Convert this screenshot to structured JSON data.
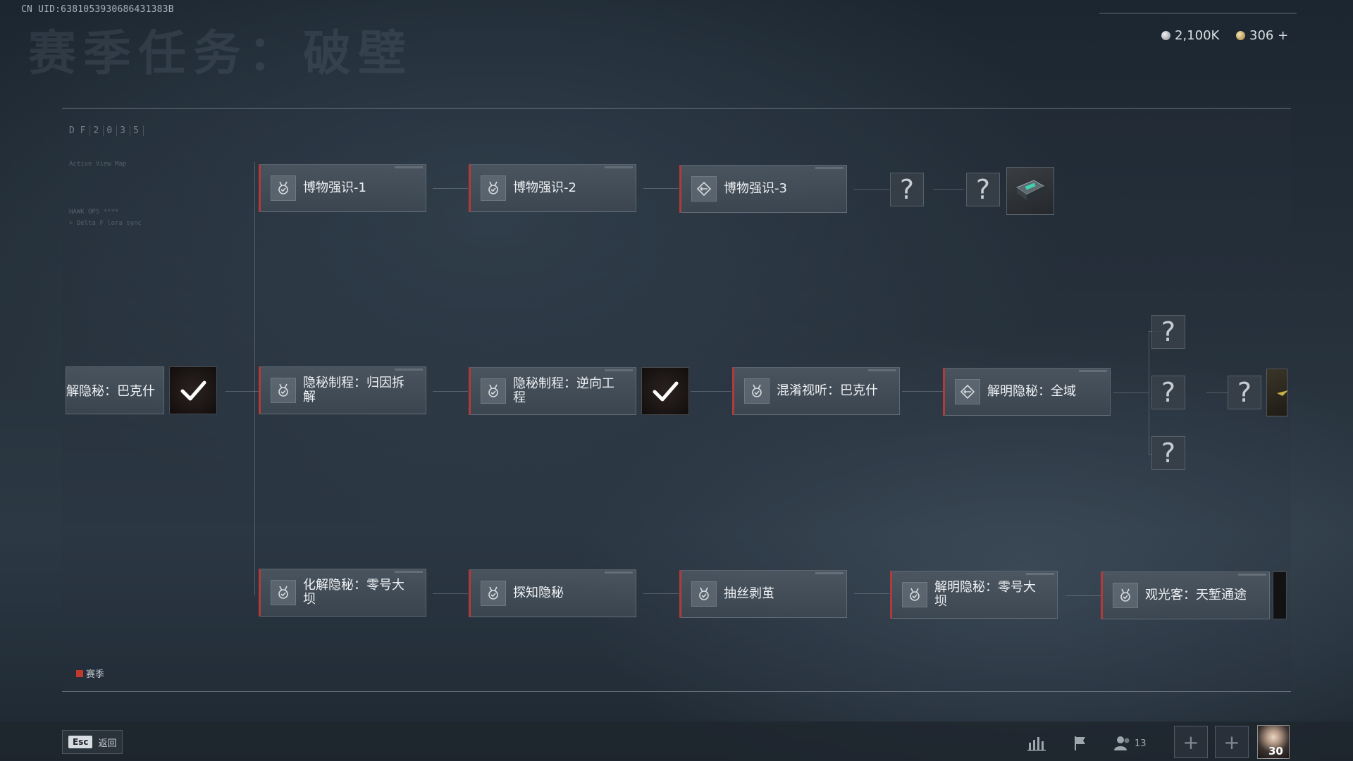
{
  "uid": "CN UID:6381053930686431383B",
  "title": "赛季任务：破壁",
  "currency": {
    "silver": "2,100K",
    "gold": "306 +"
  },
  "frame": {
    "act_code": [
      "D F",
      "2",
      "0",
      "3",
      "5"
    ],
    "faint_lines": [
      "Active View Map",
      "HAWK OPS ****",
      "+ Delta F lora sync"
    ]
  },
  "rows": {
    "top": [
      {
        "label": "博物强识-1",
        "icon": "medal-check-icon"
      },
      {
        "label": "博物强识-2",
        "icon": "medal-check-icon"
      },
      {
        "label": "博物强识-3",
        "icon": "diamond-arrows-icon"
      }
    ],
    "middle_left": {
      "label": "解隐秘：巴克什"
    },
    "middle": [
      {
        "label": "隐秘制程：归因拆解",
        "icon": "medal-check-icon"
      },
      {
        "label": "隐秘制程：逆向工程",
        "icon": "medal-check-icon"
      },
      {
        "label": "混淆视听：巴克什",
        "icon": "medal-check-icon"
      },
      {
        "label": "解明隐秘：全域",
        "icon": "diamond-arrows-icon"
      }
    ],
    "bottom": [
      {
        "label": "化解隐秘：零号大坝",
        "icon": "medal-check-icon"
      },
      {
        "label": "探知隐秘",
        "icon": "medal-check-icon"
      },
      {
        "label": "抽丝剥茧",
        "icon": "medal-check-icon"
      },
      {
        "label": "解明隐秘：零号大坝",
        "icon": "medal-check-icon"
      },
      {
        "label": "观光客：天堑通途",
        "icon": "medal-check-icon"
      }
    ]
  },
  "mystery_symbol": "?",
  "legend": {
    "label": "赛季",
    "color": "#c0392b"
  },
  "bottom_bar": {
    "esc_key": "Esc",
    "back_label": "返回",
    "friends_count": "13",
    "level": "30"
  }
}
